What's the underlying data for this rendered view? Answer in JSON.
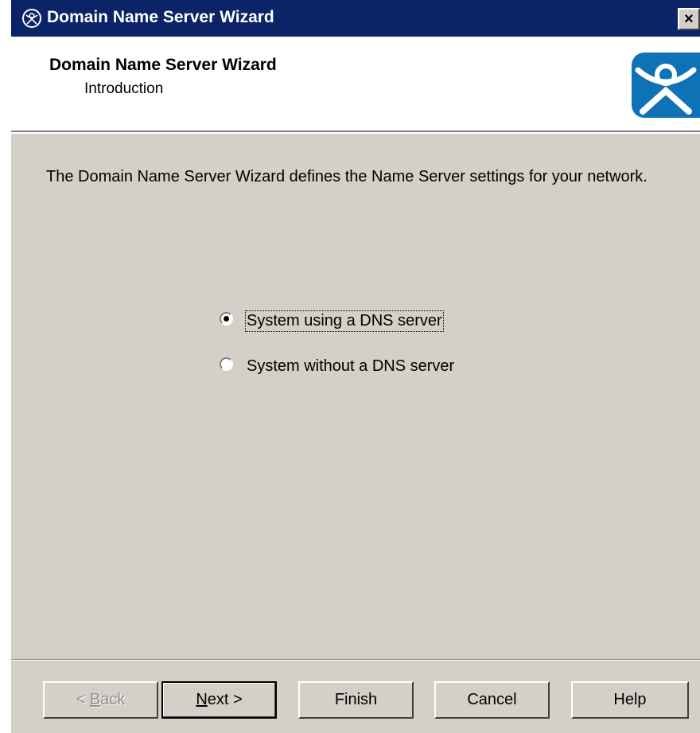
{
  "window": {
    "title": "Domain Name Server Wizard",
    "close_glyph": "×",
    "icon": "thinmanager-logo-icon"
  },
  "header": {
    "title": "Domain Name Server Wizard",
    "subtitle": "Introduction",
    "logo": "thinmanager-logo-icon"
  },
  "body": {
    "description": "The Domain Name Server Wizard defines the Name Server settings for your network."
  },
  "options": [
    {
      "label": "System using a DNS server",
      "selected": true
    },
    {
      "label": "System without a DNS server",
      "selected": false
    }
  ],
  "buttons": {
    "back": {
      "prefix": "< ",
      "mnemonic": "B",
      "rest": "ack",
      "enabled": false
    },
    "next": {
      "mnemonic": "N",
      "rest": "ext >",
      "enabled": true
    },
    "finish": "Finish",
    "cancel": "Cancel",
    "help": "Help"
  },
  "colors": {
    "titlebar": "#0b2468",
    "dialog_bg": "#d4d0c8",
    "logo_blue": "#0f72b6"
  }
}
